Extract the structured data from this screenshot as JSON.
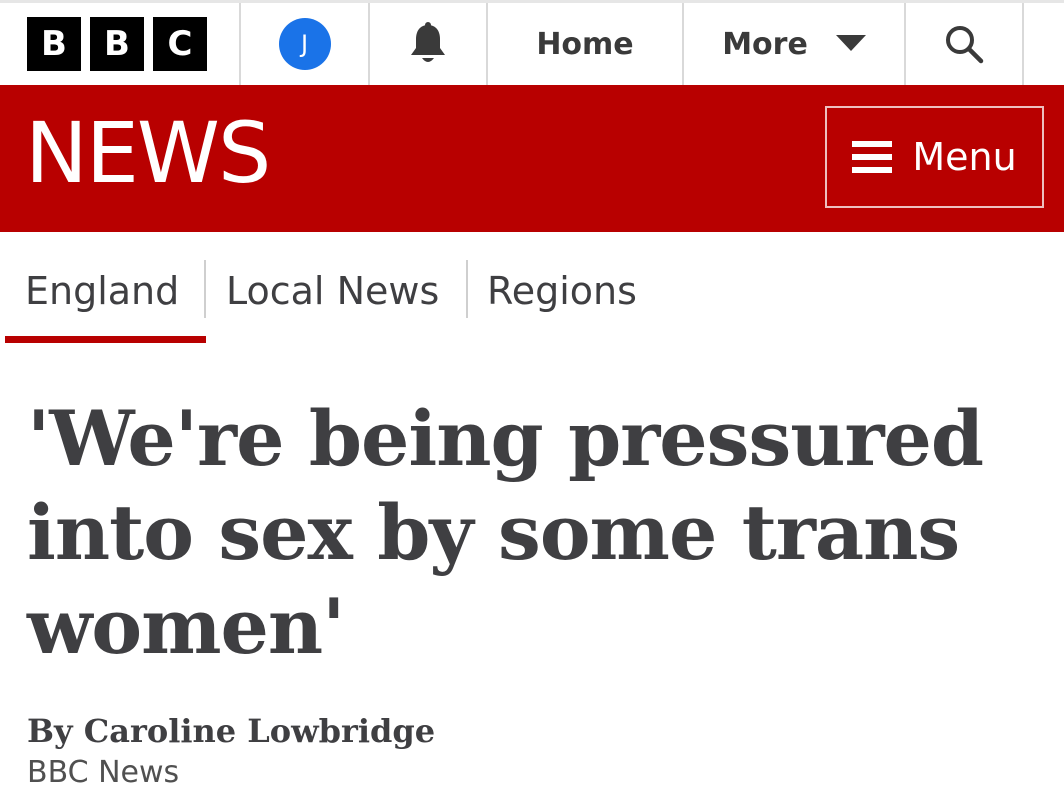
{
  "header": {
    "logo_letters": [
      "B",
      "B",
      "C"
    ],
    "avatar_initial": "J",
    "home_label": "Home",
    "more_label": "More",
    "icons": {
      "notifications": "bell-icon",
      "more": "caret-down-icon",
      "search": "search-icon"
    }
  },
  "news_band": {
    "title": "NEWS",
    "menu_label": "Menu",
    "color": "#b80000"
  },
  "subnav": {
    "items": [
      "England",
      "Local News",
      "Regions"
    ],
    "active": "England"
  },
  "article": {
    "headline": "'We're being pressured into sex by some trans women'",
    "byline": "By Caroline Lowbridge",
    "source": "BBC News"
  }
}
